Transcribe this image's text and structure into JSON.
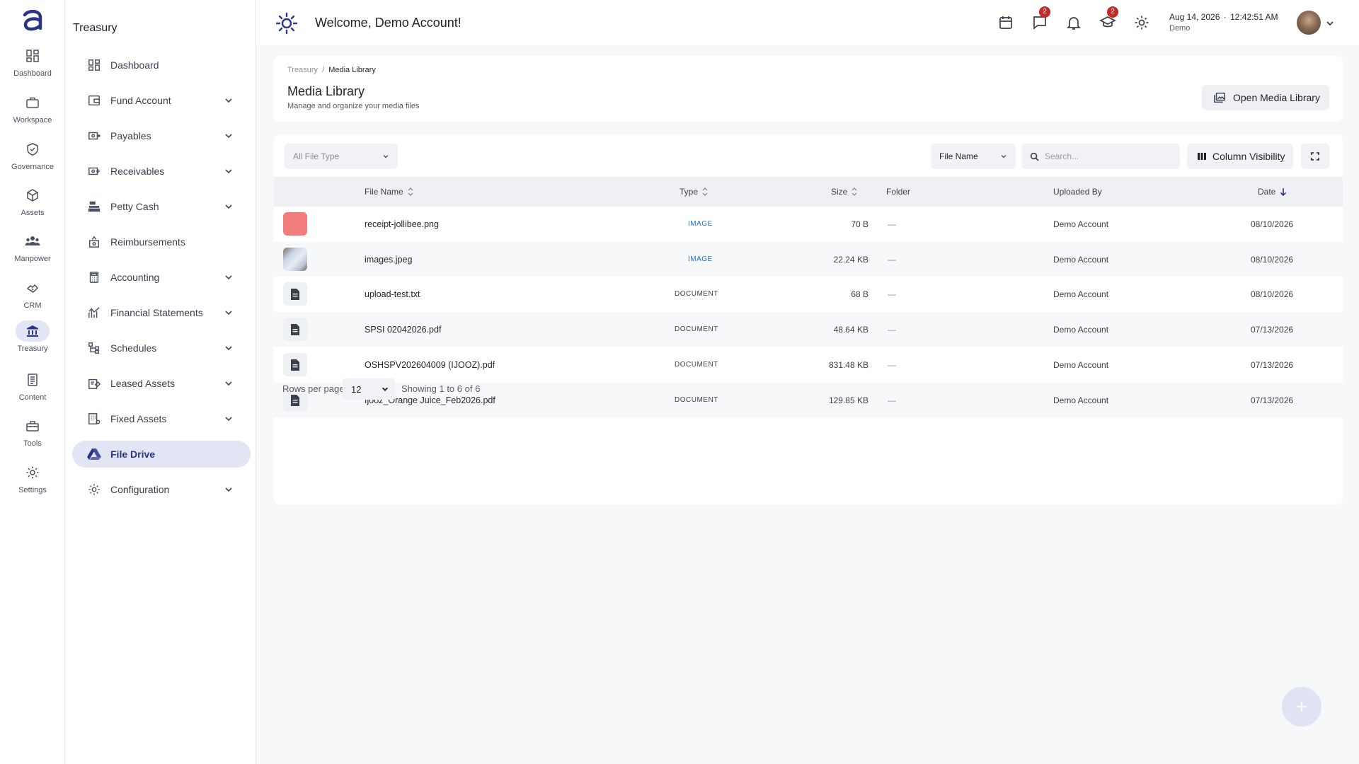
{
  "rail": {
    "items": [
      {
        "label": "Dashboard",
        "icon": "dashboard-icon"
      },
      {
        "label": "Workspace",
        "icon": "briefcase-icon"
      },
      {
        "label": "Governance",
        "icon": "shield-icon"
      },
      {
        "label": "Assets",
        "icon": "cube-icon"
      },
      {
        "label": "Manpower",
        "icon": "people-icon"
      },
      {
        "label": "CRM",
        "icon": "handshake-icon"
      },
      {
        "label": "Treasury",
        "icon": "bank-icon"
      },
      {
        "label": "Content",
        "icon": "document-icon"
      },
      {
        "label": "Tools",
        "icon": "toolbox-icon"
      },
      {
        "label": "Settings",
        "icon": "gear-icon"
      }
    ],
    "active": "Treasury"
  },
  "sidebar": {
    "title": "Treasury",
    "items": [
      {
        "label": "Dashboard",
        "icon": "dashboard-icon",
        "expandable": false
      },
      {
        "label": "Fund Account",
        "icon": "wallet-icon",
        "expandable": true
      },
      {
        "label": "Payables",
        "icon": "payables-icon",
        "expandable": true
      },
      {
        "label": "Receivables",
        "icon": "receivables-icon",
        "expandable": true
      },
      {
        "label": "Petty Cash",
        "icon": "cash-register-icon",
        "expandable": true
      },
      {
        "label": "Reimbursements",
        "icon": "reimbursement-icon",
        "expandable": false
      },
      {
        "label": "Accounting",
        "icon": "calculator-icon",
        "expandable": true
      },
      {
        "label": "Financial Statements",
        "icon": "chart-icon",
        "expandable": true
      },
      {
        "label": "Schedules",
        "icon": "schedule-tree-icon",
        "expandable": true
      },
      {
        "label": "Leased Assets",
        "icon": "lease-icon",
        "expandable": true
      },
      {
        "label": "Fixed Assets",
        "icon": "fixed-assets-icon",
        "expandable": true
      },
      {
        "label": "File Drive",
        "icon": "drive-icon",
        "expandable": false
      },
      {
        "label": "Configuration",
        "icon": "gear-icon",
        "expandable": true
      }
    ],
    "active": "File Drive"
  },
  "topbar": {
    "welcome": "Welcome, Demo Account!",
    "messages_badge": "2",
    "courses_badge": "2",
    "date": "Aug 14, 2026",
    "separator": "·",
    "time": "12:42:51 AM",
    "user_sub": "Demo"
  },
  "header": {
    "breadcrumb_root": "Treasury",
    "breadcrumb_sep": "/",
    "breadcrumb_current": "Media Library",
    "title": "Media Library",
    "subtitle": "Manage and organize your media files",
    "open_button": "Open Media Library"
  },
  "toolbar": {
    "file_type_filter": "All File Type",
    "search_field": "File Name",
    "search_placeholder": "Search...",
    "column_visibility": "Column Visibility"
  },
  "table": {
    "columns": [
      "File Name",
      "Type",
      "Size",
      "Folder",
      "Uploaded By",
      "Date"
    ],
    "rows": [
      {
        "thumb": "red",
        "name": "receipt-jollibee.png",
        "type": "IMAGE",
        "size": "70 B",
        "folder": "—",
        "uploaded_by": "Demo Account",
        "date": "08/10/2026"
      },
      {
        "thumb": "photo",
        "name": "images.jpeg",
        "type": "IMAGE",
        "size": "22.24 KB",
        "folder": "—",
        "uploaded_by": "Demo Account",
        "date": "08/10/2026"
      },
      {
        "thumb": "doc",
        "name": "upload-test.txt",
        "type": "DOCUMENT",
        "size": "68 B",
        "folder": "—",
        "uploaded_by": "Demo Account",
        "date": "08/10/2026"
      },
      {
        "thumb": "doc",
        "name": "SPSI 02042026.pdf",
        "type": "DOCUMENT",
        "size": "48.64 KB",
        "folder": "—",
        "uploaded_by": "Demo Account",
        "date": "07/13/2026"
      },
      {
        "thumb": "doc",
        "name": "OSHSPV202604009 (IJOOZ).pdf",
        "type": "DOCUMENT",
        "size": "831.48 KB",
        "folder": "—",
        "uploaded_by": "Demo Account",
        "date": "07/13/2026"
      },
      {
        "thumb": "doc",
        "name": "Ijooz_Orange Juice_Feb2026.pdf",
        "type": "DOCUMENT",
        "size": "129.85 KB",
        "folder": "—",
        "uploaded_by": "Demo Account",
        "date": "07/13/2026"
      }
    ]
  },
  "footer": {
    "rows_per_page_label": "Rows per page:",
    "rows_per_page": "12",
    "showing": "Showing 1 to 6 of 6"
  },
  "colors": {
    "accent": "#2b3585",
    "active_bg": "#e2e5f4",
    "badge": "#c62828",
    "image_type": "#1d6fd0"
  }
}
